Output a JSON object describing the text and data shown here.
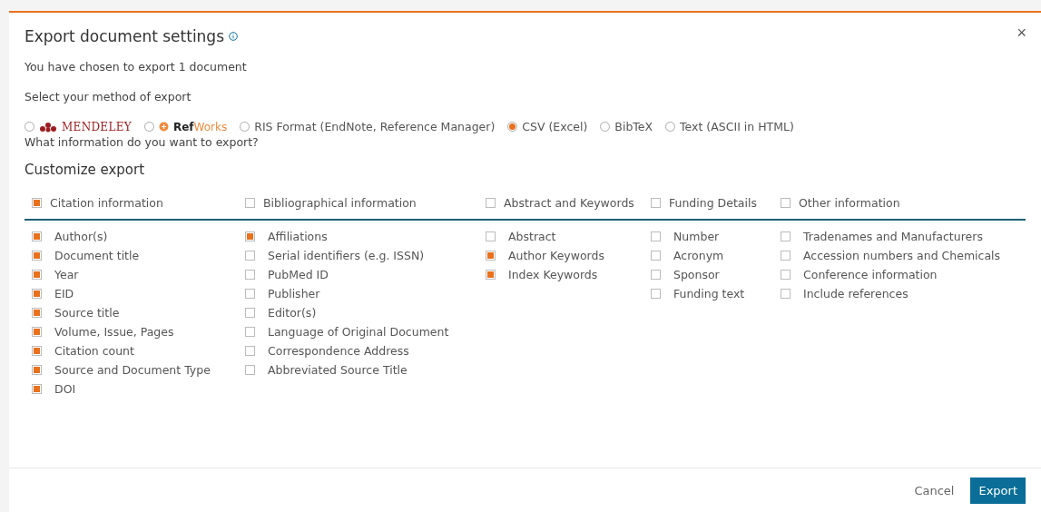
{
  "dialog": {
    "title": "Export document settings",
    "close": "×",
    "summary": "You have chosen to export 1 document",
    "method_prompt": "Select your method of export",
    "methods": [
      {
        "kind": "mendeley",
        "label": "MENDELEY",
        "selected": false
      },
      {
        "kind": "refworks",
        "label": "**Ref**Works",
        "selected": false
      },
      {
        "kind": "text",
        "label": "RIS Format (EndNote, Reference Manager)",
        "selected": false
      },
      {
        "kind": "text",
        "label": "CSV (Excel)",
        "selected": true
      },
      {
        "kind": "text",
        "label": "BibTeX",
        "selected": false
      },
      {
        "kind": "text",
        "label": "Text (ASCII in HTML)",
        "selected": false
      }
    ],
    "info_prompt": "What information do you want to export?",
    "customize_title": "Customize export",
    "groups": [
      {
        "label": "Citation information",
        "checked": true,
        "items": [
          {
            "label": "Author(s)",
            "checked": true
          },
          {
            "label": "Document title",
            "checked": true
          },
          {
            "label": "Year",
            "checked": true
          },
          {
            "label": "EID",
            "checked": true
          },
          {
            "label": "Source title",
            "checked": true
          },
          {
            "label": "Volume, Issue, Pages",
            "checked": true
          },
          {
            "label": "Citation count",
            "checked": true
          },
          {
            "label": "Source and Document Type",
            "checked": true
          },
          {
            "label": "DOI",
            "checked": true
          }
        ]
      },
      {
        "label": "Bibliographical information",
        "checked": false,
        "items": [
          {
            "label": "Affiliations",
            "checked": true
          },
          {
            "label": "Serial identifiers (e.g. ISSN)",
            "checked": false
          },
          {
            "label": "PubMed ID",
            "checked": false
          },
          {
            "label": "Publisher",
            "checked": false
          },
          {
            "label": "Editor(s)",
            "checked": false
          },
          {
            "label": "Language of Original Document",
            "checked": false
          },
          {
            "label": "Correspondence Address",
            "checked": false
          },
          {
            "label": "Abbreviated Source Title",
            "checked": false
          }
        ]
      },
      {
        "label": "Abstract and Keywords",
        "checked": false,
        "items": [
          {
            "label": "Abstract",
            "checked": false
          },
          {
            "label": "Author Keywords",
            "checked": true
          },
          {
            "label": "Index Keywords",
            "checked": true
          }
        ]
      },
      {
        "label": "Funding Details",
        "checked": false,
        "items": [
          {
            "label": "Number",
            "checked": false
          },
          {
            "label": "Acronym",
            "checked": false
          },
          {
            "label": "Sponsor",
            "checked": false
          },
          {
            "label": "Funding text",
            "checked": false
          }
        ]
      },
      {
        "label": "Other information",
        "checked": false,
        "items": [
          {
            "label": "Tradenames and Manufacturers",
            "checked": false
          },
          {
            "label": "Accession numbers and Chemicals",
            "checked": false
          },
          {
            "label": "Conference information",
            "checked": false
          },
          {
            "label": "Include references",
            "checked": false
          }
        ]
      }
    ],
    "buttons": {
      "cancel": "Cancel",
      "confirm": "Export"
    }
  }
}
